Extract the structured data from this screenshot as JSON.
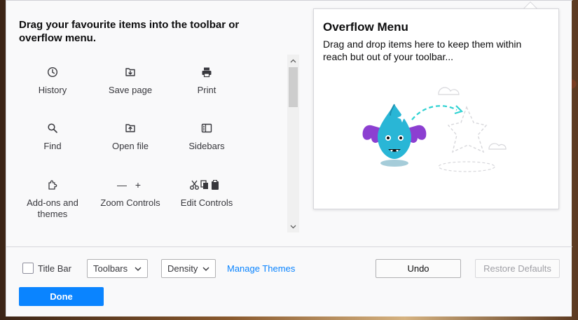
{
  "heading": "Drag your favourite items into the toolbar or overflow menu.",
  "palette": [
    {
      "label": "History",
      "icon": "clock-icon"
    },
    {
      "label": "Save page",
      "icon": "save-page-icon"
    },
    {
      "label": "Print",
      "icon": "printer-icon"
    },
    {
      "label": "Find",
      "icon": "search-icon"
    },
    {
      "label": "Open file",
      "icon": "open-file-icon"
    },
    {
      "label": "Sidebars",
      "icon": "sidebar-icon"
    },
    {
      "label": "Add-ons and themes",
      "icon": "puzzle-icon"
    },
    {
      "label": "Zoom Controls",
      "icon": "zoom-controls-icon",
      "glyph": "— +"
    },
    {
      "label": "Edit Controls",
      "icon": "edit-controls-icon"
    }
  ],
  "overflow": {
    "title": "Overflow Menu",
    "text": "Drag and drop items here to keep them within reach but out of your toolbar..."
  },
  "footer": {
    "title_bar_label": "Title Bar",
    "toolbars_label": "Toolbars",
    "density_label": "Density",
    "manage_themes_label": "Manage Themes",
    "undo_label": "Undo",
    "restore_label": "Restore Defaults",
    "done_label": "Done"
  },
  "colors": {
    "accent": "#0a84ff",
    "dragon_body": "#29b6d6",
    "dragon_wing": "#8c3fd1"
  }
}
